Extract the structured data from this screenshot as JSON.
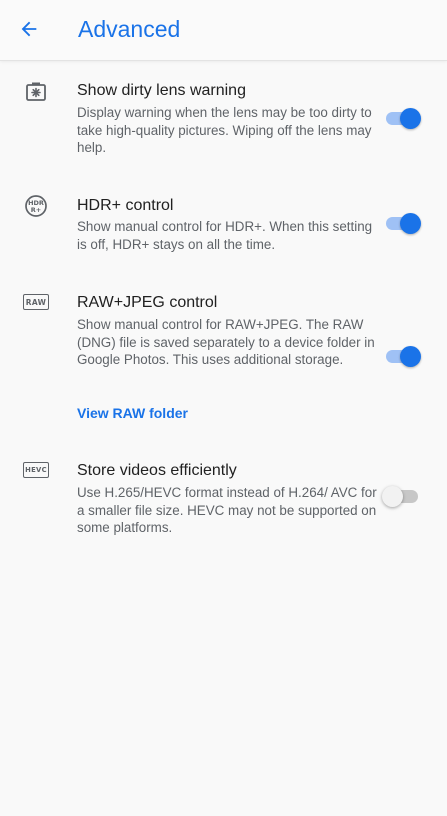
{
  "header": {
    "title": "Advanced",
    "back_icon": "arrow-back-icon"
  },
  "settings": [
    {
      "icon": "dirty-lens-icon",
      "title": "Show dirty lens warning",
      "description": "Display warning when the lens may be too dirty to take high-quality pictures. Wiping off the lens may help.",
      "enabled": true
    },
    {
      "icon": "hdr-plus-icon",
      "icon_text_top": "HDR",
      "icon_text_bottom": "R+",
      "title": "HDR+ control",
      "description": "Show manual control for HDR+. When this setting is off, HDR+ stays on all the time.",
      "enabled": true
    },
    {
      "icon": "raw-icon",
      "icon_text": "RAW",
      "title": "RAW+JPEG control",
      "description": "Show manual control for RAW+JPEG. The RAW (DNG) file is saved separately to a device folder in Google Photos. This uses additional storage.",
      "enabled": true,
      "link": "View RAW folder"
    },
    {
      "icon": "hevc-icon",
      "icon_text": "HEVC",
      "title": "Store videos efficiently",
      "description": "Use H.265/HEVC format instead of H.264/ AVC for a smaller file size. HEVC may not be supported on some platforms.",
      "enabled": false
    }
  ],
  "colors": {
    "accent": "#1a73e8",
    "background": "#f9f9f9",
    "title_text": "#212121",
    "secondary_text": "#5f6368"
  }
}
